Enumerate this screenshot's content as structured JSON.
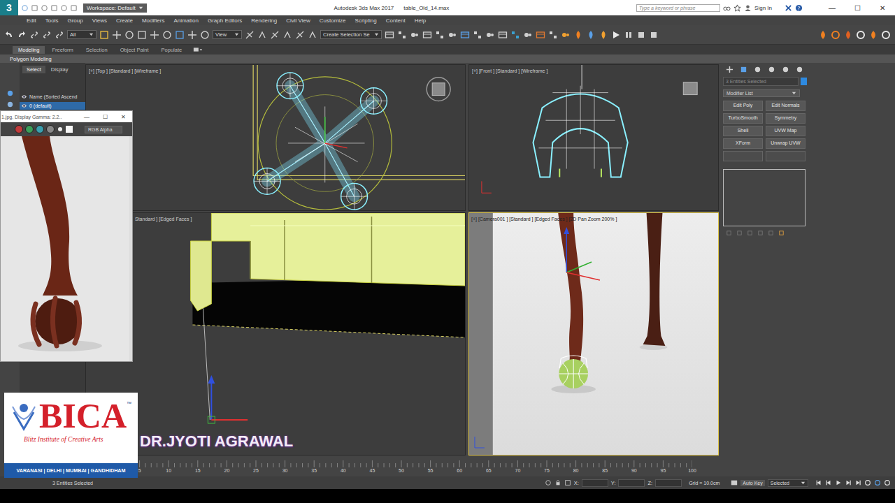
{
  "title_bar": {
    "app_icon": "3",
    "workspace": "Workspace: Default",
    "title": "Autodesk 3ds Max 2017",
    "file": "table_Old_14.max",
    "search_placeholder": "Type a keyword or phrase",
    "sign_in": "Sign In",
    "controls": [
      "—",
      "☐",
      "✕"
    ]
  },
  "menu": [
    "Edit",
    "Tools",
    "Group",
    "Views",
    "Create",
    "Modifiers",
    "Animation",
    "Graph Editors",
    "Rendering",
    "Civil View",
    "Customize",
    "Scripting",
    "Content",
    "Help"
  ],
  "toolbar": {
    "selection_filter": "All",
    "reference_coordinate": "View",
    "named_selection": "Create Selection Se"
  },
  "ribbon": {
    "tabs": [
      {
        "label": "Modeling",
        "selected": true
      },
      {
        "label": "Freeform",
        "selected": false
      },
      {
        "label": "Selection",
        "selected": false
      },
      {
        "label": "Object Paint",
        "selected": false
      },
      {
        "label": "Populate",
        "selected": false
      }
    ],
    "panel": "Polygon Modeling"
  },
  "scene_explorer": {
    "tabs": [
      {
        "label": "Select",
        "selected": true
      },
      {
        "label": "Display",
        "selected": false
      }
    ],
    "rows": [
      {
        "label": "Name (Sorted Ascend",
        "selected": false
      },
      {
        "label": "0 (default)",
        "selected": true
      }
    ]
  },
  "image_window": {
    "title": "1.jpg, Display Gamma: 2.2..",
    "controls": [
      "—",
      "☐",
      "✕"
    ],
    "channels": [
      {
        "color": "#c23b3b"
      },
      {
        "color": "#3b9e5a"
      },
      {
        "color": "#3a9fae"
      }
    ],
    "display": "RGB Alpha"
  },
  "viewports": [
    {
      "label": "[+] [Top ] [Standard ] [Wireframe ]",
      "kind": "top",
      "active": false
    },
    {
      "label": "[+] [Front ] [Standard ] [Wireframe ]",
      "kind": "front",
      "active": false
    },
    {
      "label": "Standard ] [Edged Faces ]",
      "kind": "perspective",
      "active": false
    },
    {
      "label": "[+] [Camera001 ] [Standard ] [Edged Faces ] [2D Pan Zoom 200% ]",
      "kind": "camera",
      "active": true
    }
  ],
  "command_panel": {
    "selection": "3 Entities Selected",
    "modifier_list": "Modifier List",
    "modifiers": [
      "Edit Poly",
      "Edit Normals",
      "TurboSmooth",
      "Symmetry",
      "Shell",
      "UVW Map",
      "XForm",
      "Unwrap UVW"
    ]
  },
  "timeline": {
    "ticks": [
      "5",
      "10",
      "15",
      "20",
      "25",
      "30",
      "35",
      "40",
      "45",
      "50",
      "55",
      "60",
      "65",
      "70",
      "75",
      "80",
      "85",
      "90",
      "95",
      "100"
    ]
  },
  "status_bar": {
    "selection": "3 Entities Selected",
    "coordinates": [
      "X:",
      "Y:",
      "Z:"
    ],
    "grid": "Grid = 10.0cm",
    "auto_key": "Auto Key",
    "key_filter": "Selected"
  },
  "overlay": {
    "logo": "BICA",
    "trademark": "™",
    "tagline": "Blitz Institute of Creative Arts",
    "cities": "VARANASI | DELHI | MUMBAI | GANDHIDHAM",
    "author": "DR.JYOTI AGRAWAL"
  }
}
